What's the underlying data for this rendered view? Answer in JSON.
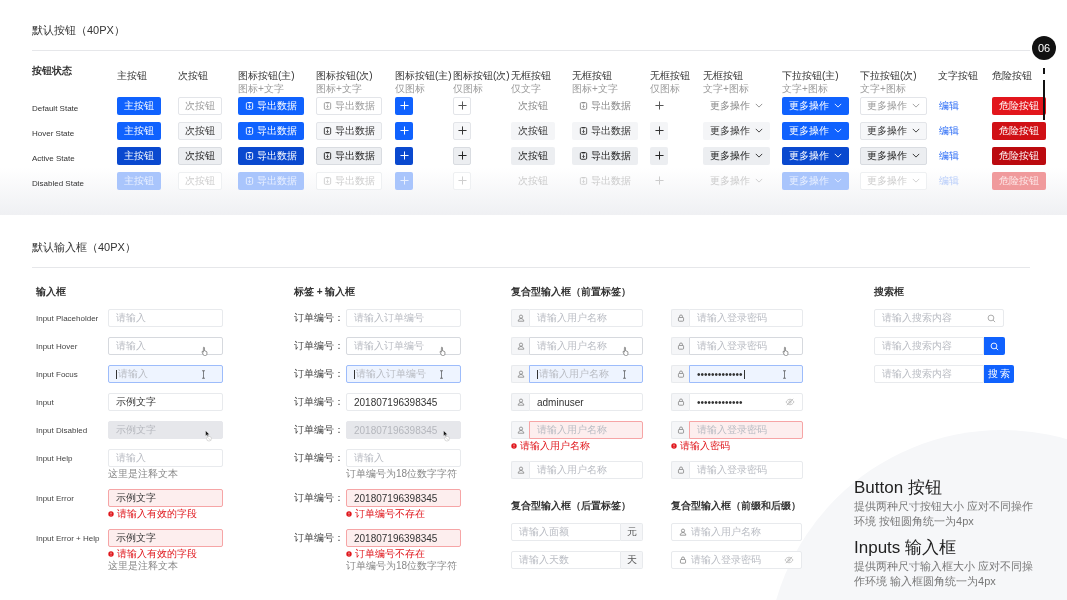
{
  "button_section": {
    "title": "默认按钮（40PX）",
    "page_number": "06",
    "corner_label": "按钮状态",
    "columns": [
      {
        "title": "主按钮",
        "kind": "primary"
      },
      {
        "title": "次按钮",
        "kind": "secondary"
      },
      {
        "title": "图标按钮(主)",
        "subtitle": "图标+文字",
        "kind": "primary_icon_text"
      },
      {
        "title": "图标按钮(次)",
        "subtitle": "图标+文字",
        "kind": "secondary_icon_text"
      },
      {
        "title": "图标按钮(主)",
        "subtitle": "仅图标",
        "kind": "primary_icon"
      },
      {
        "title": "图标按钮(次)",
        "subtitle": "仅图标",
        "kind": "secondary_icon"
      },
      {
        "title": "无框按钮",
        "subtitle": "仅文字",
        "kind": "ghost"
      },
      {
        "title": "无框按钮",
        "subtitle": "图标+文字",
        "kind": "ghost_icon_text"
      },
      {
        "title": "无框按钮",
        "subtitle": "仅图标",
        "kind": "ghost_icon"
      },
      {
        "title": "无框按钮",
        "subtitle": "文字+图标",
        "kind": "ghost_dropdown"
      },
      {
        "title": "下拉按钮(主)",
        "subtitle": "文字+图标",
        "kind": "primary_dropdown"
      },
      {
        "title": "下拉按钮(次)",
        "subtitle": "文字+图标",
        "kind": "secondary_dropdown"
      },
      {
        "title": "文字按钮",
        "kind": "link"
      },
      {
        "title": "危险按钮",
        "kind": "danger"
      }
    ],
    "rows": [
      {
        "label": "Default State",
        "kind": "default",
        "cells": [
          {
            "text": "主按钮"
          },
          {
            "text": "次按钮"
          },
          {
            "text": "导出数据"
          },
          {
            "text": "导出数据"
          },
          {},
          {},
          {
            "text": "次按钮"
          },
          {
            "text": "导出数据"
          },
          {},
          {
            "text": "更多操作"
          },
          {
            "text": "更多操作"
          },
          {
            "text": "更多操作"
          },
          {
            "text": "编辑"
          },
          {
            "text": "危险按钮"
          }
        ]
      },
      {
        "label": "Hover State",
        "kind": "hover",
        "cells": [
          {
            "text": "主按钮"
          },
          {
            "text": "次按钮"
          },
          {
            "text": "导出数据"
          },
          {
            "text": "导出数据"
          },
          {},
          {},
          {
            "text": "次按钮"
          },
          {
            "text": "导出数据"
          },
          {},
          {
            "text": "更多操作"
          },
          {
            "text": "更多操作"
          },
          {
            "text": "更多操作"
          },
          {
            "text": "编辑"
          },
          {
            "text": "危险按钮"
          }
        ]
      },
      {
        "label": "Active State",
        "kind": "active",
        "cells": [
          {
            "text": "主按钮"
          },
          {
            "text": "次按钮"
          },
          {
            "text": "导出数据"
          },
          {
            "text": "导出数据"
          },
          {},
          {},
          {
            "text": "次按钮"
          },
          {
            "text": "导出数据"
          },
          {},
          {
            "text": "更多操作"
          },
          {
            "text": "更多操作"
          },
          {
            "text": "更多操作"
          },
          {
            "text": "编辑"
          },
          {
            "text": "危险按钮"
          }
        ]
      },
      {
        "label": "Disabled State",
        "kind": "disabled",
        "cells": [
          {
            "text": "主按钮"
          },
          {
            "text": "次按钮"
          },
          {
            "text": "导出数据"
          },
          {
            "text": "导出数据"
          },
          {},
          {},
          {
            "text": "次按钮"
          },
          {
            "text": "导出数据"
          },
          {},
          {
            "text": "更多操作"
          },
          {
            "text": "更多操作"
          },
          {
            "text": "更多操作"
          },
          {
            "text": "编辑"
          },
          {
            "text": "危险按钮"
          }
        ]
      }
    ]
  },
  "input_section": {
    "title": "默认输入框（40PX）",
    "basic": {
      "title": "输入框",
      "rows": [
        {
          "label": "Input Placeholder",
          "kind": "normal",
          "placeholder": "请输入"
        },
        {
          "label": "Input Hover",
          "kind": "hover",
          "placeholder": "请输入"
        },
        {
          "label": "Input Focus",
          "kind": "focus",
          "placeholder": "请输入"
        },
        {
          "label": "Input",
          "kind": "filled",
          "value": "示例文字"
        },
        {
          "label": "Input Disabled",
          "kind": "disabled",
          "value": "示例文字"
        },
        {
          "label": "Input Help",
          "kind": "normal",
          "placeholder": "请输入",
          "help": "这里是注释文本"
        },
        {
          "label": "Input Error",
          "kind": "error",
          "value": "示例文字",
          "error": "请输入有效的字段"
        },
        {
          "label": "Input Error + Help",
          "kind": "error",
          "value": "示例文字",
          "error": "请输入有效的字段",
          "help": "这里是注释文本"
        }
      ]
    },
    "labeled": {
      "title": "标签 + 输入框",
      "rows": [
        {
          "label": "订单编号：",
          "kind": "normal",
          "placeholder": "请输入订单编号"
        },
        {
          "label": "订单编号：",
          "kind": "hover",
          "placeholder": "请输入订单编号"
        },
        {
          "label": "订单编号：",
          "kind": "focus",
          "placeholder": "请输入订单编号"
        },
        {
          "label": "订单编号：",
          "kind": "filled",
          "value": "201807196398345"
        },
        {
          "label": "订单编号：",
          "kind": "disabled",
          "value": "201807196398345"
        },
        {
          "label": "订单编号：",
          "kind": "normal",
          "placeholder": "请输入",
          "help": "订单编号为18位数字字符"
        },
        {
          "label": "订单编号：",
          "kind": "error",
          "value": "201807196398345",
          "error": "订单编号不存在"
        },
        {
          "label": "订单编号：",
          "kind": "error",
          "value": "201807196398345",
          "error": "订单编号不存在",
          "help": "订单编号为18位数字字符"
        }
      ]
    },
    "prefix_addon": {
      "title": "复合型输入框（前置标签）",
      "columns": [
        [
          {
            "kind": "normal",
            "placeholder": "请输入用户名称"
          },
          {
            "kind": "hover",
            "placeholder": "请输入用户名称"
          },
          {
            "kind": "focus",
            "placeholder": "请输入用户名称"
          },
          {
            "kind": "filled",
            "value": "adminuser"
          },
          {
            "kind": "error",
            "placeholder": "请输入用户名称",
            "error": "请输入用户名称"
          },
          {
            "kind": "normal",
            "placeholder": "请输入用户名称"
          }
        ],
        [
          {
            "kind": "normal",
            "placeholder": "请输入登录密码"
          },
          {
            "kind": "hover",
            "placeholder": "请输入登录密码"
          },
          {
            "kind": "focus",
            "value": "•••••••••••••"
          },
          {
            "kind": "filled",
            "value": "•••••••••••••"
          },
          {
            "kind": "error",
            "placeholder": "请输入登录密码",
            "error": "请输入密码"
          },
          {
            "kind": "normal",
            "placeholder": "请输入登录密码"
          }
        ]
      ]
    },
    "suffix_addon": {
      "title": "复合型输入框（后置标签）",
      "rows": [
        {
          "placeholder": "请输入面额",
          "addon": "元"
        },
        {
          "placeholder": "请输入天数",
          "addon": "天"
        }
      ]
    },
    "affix": {
      "title": "复合型输入框（前缀和后缀）",
      "rows": [
        {
          "placeholder": "请输入用户名称"
        },
        {
          "placeholder": "请输入登录密码"
        }
      ]
    },
    "search": {
      "title": "搜索框",
      "rows": [
        {
          "kind": "icon",
          "placeholder": "请输入搜索内容"
        },
        {
          "kind": "icon_button",
          "placeholder": "请输入搜索内容"
        },
        {
          "kind": "text_button",
          "placeholder": "请输入搜索内容",
          "button_text": "搜 索"
        }
      ]
    }
  },
  "notes": [
    {
      "title": "Button 按钮",
      "text": "提供两种尺寸按钮大小 应对不同操作环境 按钮圆角统一为4px"
    },
    {
      "title": "Inputs 输入框",
      "text": "提供两种尺寸输入框大小 应对不同操作环境 输入框圆角统一为4px"
    }
  ]
}
